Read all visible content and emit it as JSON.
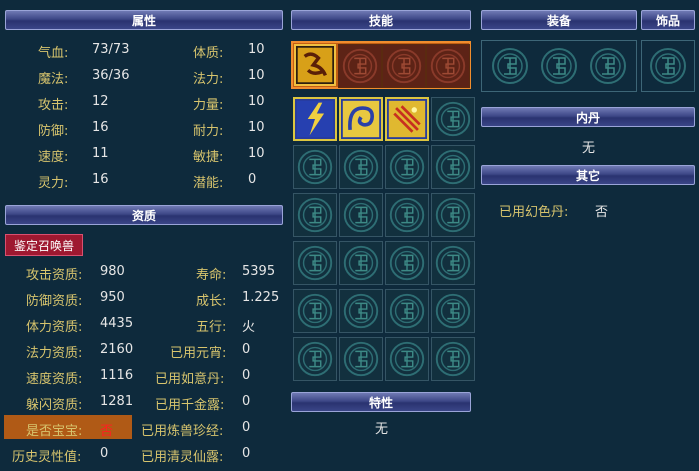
{
  "headers": {
    "attributes": "属性",
    "aptitude": "资质",
    "skills": "技能",
    "equipment": "装备",
    "accessory": "饰品",
    "inner_dan": "内丹",
    "other": "其它",
    "traits": "特性"
  },
  "attributes": [
    {
      "label": "气血:",
      "value": "73/73",
      "label2": "体质:",
      "value2": "10"
    },
    {
      "label": "魔法:",
      "value": "36/36",
      "label2": "法力:",
      "value2": "10"
    },
    {
      "label": "攻击:",
      "value": "12",
      "label2": "力量:",
      "value2": "10"
    },
    {
      "label": "防御:",
      "value": "16",
      "label2": "耐力:",
      "value2": "10"
    },
    {
      "label": "速度:",
      "value": "11",
      "label2": "敏捷:",
      "value2": "10"
    },
    {
      "label": "灵力:",
      "value": "16",
      "label2": "潜能:",
      "value2": "0"
    }
  ],
  "identify_button": "鉴定召唤兽",
  "aptitude": [
    {
      "label": "攻击资质:",
      "value": "980",
      "label2": "寿命:",
      "value2": "5395"
    },
    {
      "label": "防御资质:",
      "value": "950",
      "label2": "成长:",
      "value2": "1.225"
    },
    {
      "label": "体力资质:",
      "value": "4435",
      "label2": "五行:",
      "value2": "火"
    },
    {
      "label": "法力资质:",
      "value": "2160",
      "label2": "已用元宵:",
      "value2": "0"
    },
    {
      "label": "速度资质:",
      "value": "1116",
      "label2": "已用如意丹:",
      "value2": "0"
    },
    {
      "label": "躲闪资质:",
      "value": "1281",
      "label2": "已用千金露:",
      "value2": "0"
    },
    {
      "label": "是否宝宝:",
      "value": "否",
      "label2": "已用炼兽珍经:",
      "value2": "0"
    },
    {
      "label": "历史灵性值:",
      "value": "0",
      "label2": "已用清灵仙露:",
      "value2": "0"
    }
  ],
  "inner_dan_value": "无",
  "other": {
    "label": "已用幻色丹:",
    "value": "否"
  },
  "traits_value": "无",
  "icons": {
    "slot": "round-knot-emblem-icon",
    "skill1": "yellow-rune-skill-icon",
    "skill2": "lightning-skill-icon",
    "skill3": "swirl-skill-icon",
    "skill4": "sparkle-skill-icon"
  },
  "colors": {
    "label": "#d7c46d",
    "highlight_bg": "#b05a16",
    "no_baby_value": "#ff2020",
    "header_bg": "#3d4787"
  }
}
